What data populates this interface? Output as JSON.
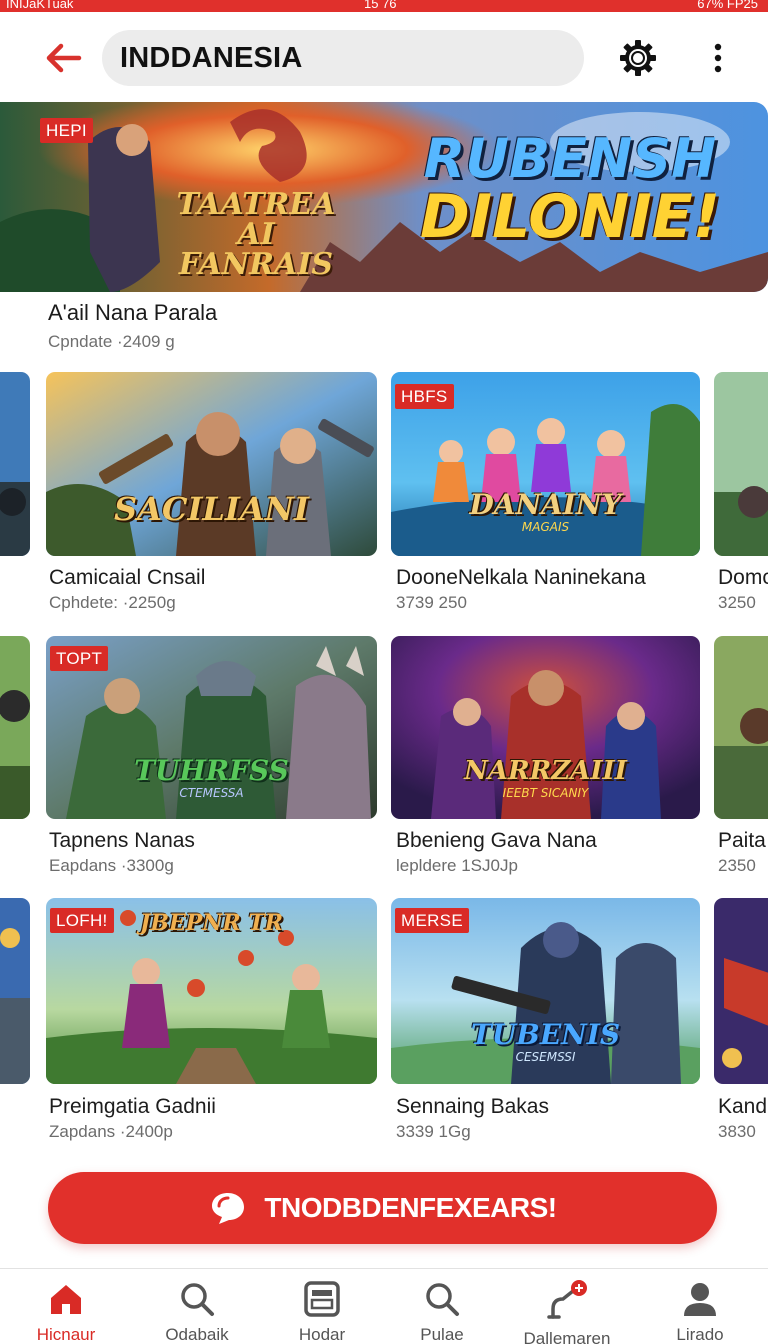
{
  "status_bar": {
    "left": "INIJaKTuak",
    "center": "15 76",
    "right": "67% FP25"
  },
  "header": {
    "search_value": "INDDANESIA",
    "back_icon": "arrow-left-icon",
    "settings_icon": "gear-icon",
    "more_icon": "more-vertical-icon"
  },
  "featured": {
    "badge": "HEPI",
    "art_title_left": "TAATREA AI FANRAIS",
    "art_title_right_line1": "RUBENSH",
    "art_title_right_line2": "DILONIE!",
    "name": "A'ail Nana Parala",
    "meta": "Cpndate ·2409 g"
  },
  "grid": {
    "rows": [
      [
        {
          "badge": "",
          "art_title": "",
          "art_sub": "",
          "title": "",
          "meta": ""
        },
        {
          "badge": "",
          "art_title": "SACILIANI",
          "art_sub": "",
          "title": "Camicaial Cnsail",
          "meta": "Cphdete: ·2250g"
        },
        {
          "badge": "HBFS",
          "art_title": "DANAINY",
          "art_sub": "MAGAIS",
          "title": "DooneNelkala Naninekana",
          "meta": "3739 250"
        },
        {
          "badge": "",
          "art_title": "",
          "art_sub": "",
          "title": "Domc",
          "meta": "3250"
        }
      ],
      [
        {
          "badge": "",
          "art_title": "",
          "art_sub": "",
          "title": "",
          "meta": ""
        },
        {
          "badge": "TOPT",
          "art_title": "TUHRFSS",
          "art_sub": "CTEMESSA",
          "title": "Tapnens Nanas",
          "meta": "Eapdans ·3300g"
        },
        {
          "badge": "",
          "art_title": "NARRZAIII",
          "art_sub": "IEEBT SICANIY",
          "title": "Bbenieng Gava Nana",
          "meta": "lepldere 1SJ0Jp"
        },
        {
          "badge": "",
          "art_title": "",
          "art_sub": "",
          "title": "Paita",
          "meta": "2350"
        }
      ],
      [
        {
          "badge": "",
          "art_title": "",
          "art_sub": "",
          "title": "",
          "meta": ""
        },
        {
          "badge": "LOFH!",
          "art_title": "JBEPNR TR",
          "art_sub": "",
          "title": "Preimgatia Gadnii",
          "meta": "Zapdans ·2400p"
        },
        {
          "badge": "MERSE",
          "art_title": "TUBENIS",
          "art_sub": "CESEMSSI",
          "title": "Sennaing Bakas",
          "meta": "3339 1Gg"
        },
        {
          "badge": "",
          "art_title": "",
          "art_sub": "",
          "title": "Kandi",
          "meta": "3830"
        }
      ]
    ]
  },
  "cta": {
    "label": "TNODBDENFEXEARS!",
    "icon": "chat-bubble-icon"
  },
  "bottom_nav": {
    "items": [
      {
        "label": "Hicnaur",
        "icon": "home-icon",
        "active": true
      },
      {
        "label": "Odabaik",
        "icon": "search-icon",
        "active": false
      },
      {
        "label": "Hodar",
        "icon": "window-icon",
        "active": false
      },
      {
        "label": "Pulae",
        "icon": "search-icon",
        "active": false
      },
      {
        "label": "Dallemaren",
        "icon": "faucet-notification-icon",
        "active": false
      },
      {
        "label": "Lirado",
        "icon": "profile-icon",
        "active": false
      }
    ]
  },
  "colors": {
    "accent": "#e0302c",
    "active_nav": "#d92b26",
    "search_bg": "#ececec"
  }
}
